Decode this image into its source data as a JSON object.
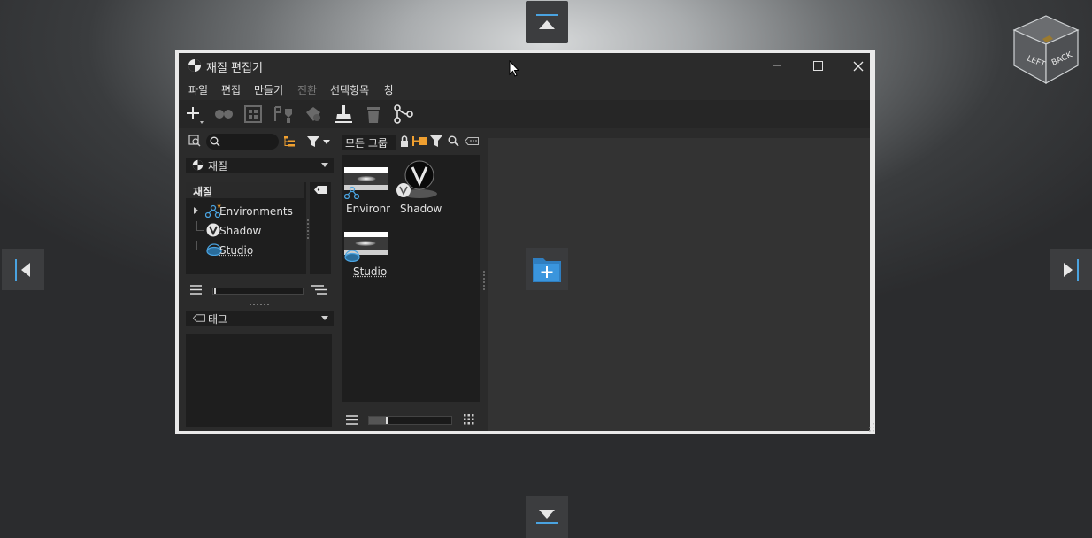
{
  "window": {
    "title": "재질 편집기",
    "controls": [
      "minimize",
      "maximize",
      "close"
    ]
  },
  "menu": [
    {
      "label": "파일",
      "enabled": true
    },
    {
      "label": "편집",
      "enabled": true
    },
    {
      "label": "만들기",
      "enabled": true
    },
    {
      "label": "전환",
      "enabled": false
    },
    {
      "label": "선택항목",
      "enabled": true
    },
    {
      "label": "창",
      "enabled": true
    }
  ],
  "toolbar": {
    "icons": [
      "add-icon",
      "toggle-icon",
      "grid-select-icon",
      "assign-icon",
      "shader-icon",
      "clean-up-icon",
      "delete-icon",
      "node-graph-icon"
    ]
  },
  "left_panel": {
    "search_placeholder": "",
    "material_dropdown": "재질",
    "tree_header": "재질",
    "tree_items": [
      {
        "label": "Environments",
        "icon": "environment-icon",
        "expandable": true
      },
      {
        "label": "Shadow",
        "icon": "shadow-v-icon",
        "expandable": false
      },
      {
        "label": "Studio",
        "icon": "studio-icon",
        "expandable": false
      }
    ],
    "tag_dropdown": "태그"
  },
  "mid_panel": {
    "group_filter": "모든 그룹",
    "items": [
      {
        "label": "Environm",
        "icon": "environment-icon"
      },
      {
        "label": "Shadow",
        "icon": "shadow-v-icon"
      },
      {
        "label": "Studio",
        "icon": "studio-icon"
      }
    ],
    "slider_value": 0.2
  },
  "colors": {
    "accent_blue": "#4aa3e0",
    "accent_orange": "#f0a030",
    "panel_bg": "#2b2b2b"
  }
}
